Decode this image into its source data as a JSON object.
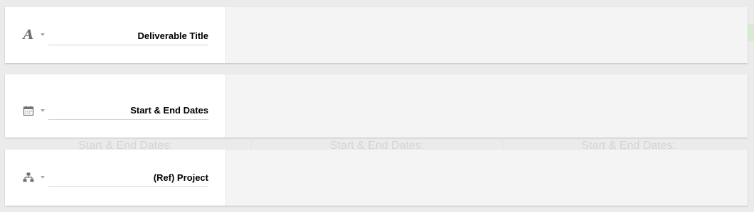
{
  "background_ghost": {
    "cells": [
      "Start & End Dates:",
      "Start & End Dates:",
      "Start & End Dates:"
    ]
  },
  "fields": [
    {
      "type_icon": "text-type-icon",
      "type_glyph": "A",
      "name": "Deliverable Title"
    },
    {
      "type_icon": "calendar-icon",
      "type_glyph": "",
      "name": "Start & End Dates"
    },
    {
      "type_icon": "hierarchy-icon",
      "type_glyph": "",
      "name": "(Ref) Project"
    }
  ],
  "colors": {
    "card_left": "#ffffff",
    "card_right": "#f4f4f4",
    "page_background": "#ebebeb",
    "icon": "#707070"
  }
}
